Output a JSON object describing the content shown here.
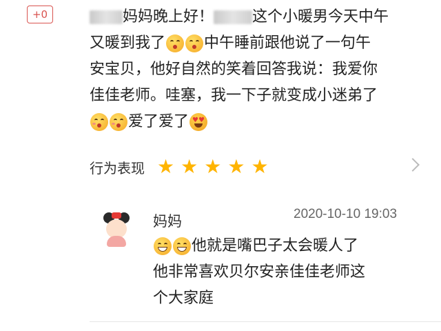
{
  "badge": {
    "label": "+0"
  },
  "post": {
    "line1_a": "妈妈晚上好！",
    "line1_b": "这个小暖男今天中午",
    "line2_a": "又暖到我了",
    "line2_b": "中午睡前跟他说了一句午",
    "line3": "安宝贝，他好自然的笑着回答我说：我爱你",
    "line4": "佳佳老师。哇塞，我一下子就变成小迷弟了",
    "line5": "爱了爱了",
    "emojis_line2": [
      "kissing-face-icon",
      "kissing-face-icon"
    ],
    "emojis_line5": [
      "kissing-heart-face-icon",
      "kissing-heart-face-icon",
      "heart-eyes-face-icon"
    ]
  },
  "rating": {
    "label": "行为表现",
    "stars": 5,
    "max": 5,
    "star_color": "#ffb400"
  },
  "reply": {
    "name": "妈妈",
    "time": "2020-10-10 19:03",
    "line1": "他就是嘴巴子太会暖人了",
    "line2": "他非常喜欢贝尔安亲佳佳老师这",
    "line3": "个大家庭",
    "emojis": [
      "grinning-face-icon",
      "grinning-face-icon"
    ]
  },
  "colors": {
    "badge": "#d9534f",
    "star": "#ffb400",
    "text": "#222222",
    "meta": "#666666"
  }
}
